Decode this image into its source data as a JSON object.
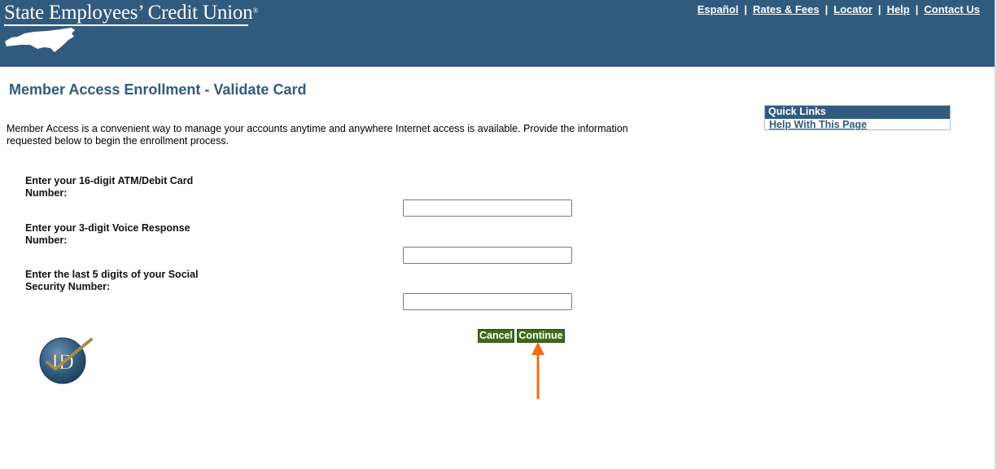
{
  "header": {
    "brand": "State Employees’ Credit Union",
    "brand_mark": "®",
    "links": [
      "Español",
      "Rates & Fees",
      "Locator",
      "Help",
      "Contact Us"
    ],
    "link_separator": "|"
  },
  "page": {
    "title": "Member Access Enrollment - Validate Card",
    "intro": "Member Access is a convenient way to manage your accounts anytime and anywhere Internet access is available. Provide the information requested below to begin the enrollment process."
  },
  "quick_links": {
    "heading": "Quick Links",
    "items": [
      "Help With This Page"
    ]
  },
  "form": {
    "card_label": "Enter your 16-digit ATM/Debit Card Number:",
    "card_value": "",
    "voice_label": "Enter your 3-digit Voice Response Number:",
    "voice_value": "",
    "ssn_label": "Enter the last 5 digits of your Social Security Number:",
    "ssn_value": ""
  },
  "buttons": {
    "cancel": "Cancel",
    "continue": "Continue"
  },
  "badge": {
    "text": "ID"
  },
  "colors": {
    "header_bg": "#315b7e",
    "title": "#315b7e",
    "button_bg": "#3d6b1a",
    "arrow": "#f26b1d"
  }
}
